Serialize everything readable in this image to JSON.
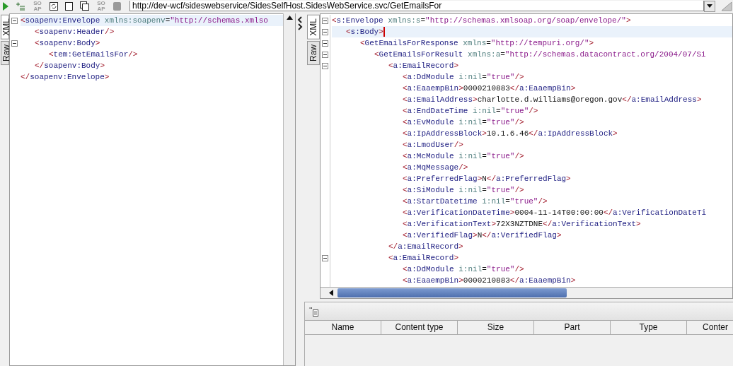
{
  "toolbar": {
    "buttons": [
      {
        "kind": "run"
      },
      {
        "kind": "add"
      },
      {
        "kind": "soap",
        "label": "SO AP"
      },
      {
        "kind": "refresh"
      },
      {
        "kind": "page"
      },
      {
        "kind": "pages"
      },
      {
        "kind": "soap",
        "label": "SO AP"
      },
      {
        "kind": "stop"
      }
    ],
    "url": "http://dev-wcf/sideswebservice/SidesSelfHost.SidesWebService.svc/GetEmailsFor"
  },
  "request": {
    "tabs": [
      {
        "label": "XML",
        "selected": true
      },
      {
        "label": "Raw",
        "selected": false
      }
    ],
    "lines": [
      {
        "expanded": true,
        "current": true,
        "tokens": [
          {
            "kind": "bracket",
            "text": "<"
          },
          {
            "kind": "tag",
            "text": "soapenv:Envelope"
          },
          {
            "kind": "attr",
            "text": " xmlns:soapenv"
          },
          {
            "kind": "equals",
            "text": "="
          },
          {
            "kind": "value",
            "text": "\"http://schemas.xmlso"
          }
        ],
        "children": [
          {
            "tokens": [
              {
                "kind": "bracket",
                "text": "<"
              },
              {
                "kind": "tag",
                "text": "soapenv:Header"
              },
              {
                "kind": "bracket",
                "text": "/>"
              }
            ]
          },
          {
            "expanded": true,
            "tokens": [
              {
                "kind": "bracket",
                "text": "<"
              },
              {
                "kind": "tag",
                "text": "soapenv:Body"
              },
              {
                "kind": "bracket",
                "text": ">"
              }
            ],
            "children": [
              {
                "tokens": [
                  {
                    "kind": "bracket",
                    "text": "<"
                  },
                  {
                    "kind": "tag",
                    "text": "tem:GetEmailsFor"
                  },
                  {
                    "kind": "bracket",
                    "text": "/>"
                  }
                ]
              }
            ]
          },
          {
            "tokens": [
              {
                "kind": "bracket",
                "text": "</"
              },
              {
                "kind": "tag",
                "text": "soapenv:Body"
              },
              {
                "kind": "bracket",
                "text": ">"
              }
            ]
          }
        ]
      },
      {
        "tokens": [
          {
            "kind": "bracket",
            "text": "</"
          },
          {
            "kind": "tag",
            "text": "soapenv:Envelope"
          },
          {
            "kind": "bracket",
            "text": ">"
          }
        ]
      }
    ]
  },
  "response": {
    "tabs": [
      {
        "label": "XML",
        "selected": true
      },
      {
        "label": "Raw",
        "selected": false
      }
    ],
    "lines": [
      {
        "expanded": true,
        "tokens": [
          {
            "kind": "bracket",
            "text": "<"
          },
          {
            "kind": "tag",
            "text": "s:Envelope"
          },
          {
            "kind": "attr",
            "text": " xmlns:s"
          },
          {
            "kind": "equals",
            "text": "="
          },
          {
            "kind": "value",
            "text": "\"http://schemas.xmlsoap.org/soap/envelope/\""
          },
          {
            "kind": "bracket",
            "text": ">"
          }
        ],
        "children": [
          {
            "expanded": true,
            "current": true,
            "tokens": [
              {
                "kind": "bracket",
                "text": "<"
              },
              {
                "kind": "tag",
                "text": "s:Body"
              },
              {
                "kind": "bracket",
                "text": ">"
              }
            ],
            "children": [
              {
                "expanded": true,
                "tokens": [
                  {
                    "kind": "bracket",
                    "text": "<"
                  },
                  {
                    "kind": "tag",
                    "text": "GetEmailsForResponse"
                  },
                  {
                    "kind": "attr",
                    "text": " xmlns"
                  },
                  {
                    "kind": "equals",
                    "text": "="
                  },
                  {
                    "kind": "value",
                    "text": "\"http://tempuri.org/\""
                  },
                  {
                    "kind": "bracket",
                    "text": ">"
                  }
                ],
                "children": [
                  {
                    "expanded": true,
                    "tokens": [
                      {
                        "kind": "bracket",
                        "text": "<"
                      },
                      {
                        "kind": "tag",
                        "text": "GetEmailsForResult"
                      },
                      {
                        "kind": "attr",
                        "text": " xmlns:a"
                      },
                      {
                        "kind": "equals",
                        "text": "="
                      },
                      {
                        "kind": "value",
                        "text": "\"http://schemas.datacontract.org/2004/07/Si"
                      }
                    ],
                    "children": [
                      {
                        "expanded": true,
                        "tokens": [
                          {
                            "kind": "bracket",
                            "text": "<"
                          },
                          {
                            "kind": "tag",
                            "text": "a:EmailRecord"
                          },
                          {
                            "kind": "bracket",
                            "text": ">"
                          }
                        ],
                        "children": [
                          {
                            "tokens": [
                              {
                                "kind": "bracket",
                                "text": "<"
                              },
                              {
                                "kind": "tag",
                                "text": "a:DdModule"
                              },
                              {
                                "kind": "attr",
                                "text": " i:nil"
                              },
                              {
                                "kind": "equals",
                                "text": "="
                              },
                              {
                                "kind": "value",
                                "text": "\"true\""
                              },
                              {
                                "kind": "bracket",
                                "text": "/>"
                              }
                            ]
                          },
                          {
                            "tokens": [
                              {
                                "kind": "bracket",
                                "text": "<"
                              },
                              {
                                "kind": "tag",
                                "text": "a:EaaempBin"
                              },
                              {
                                "kind": "bracket",
                                "text": ">"
                              },
                              {
                                "kind": "text",
                                "text": "0000210883"
                              },
                              {
                                "kind": "bracket",
                                "text": "</"
                              },
                              {
                                "kind": "tag",
                                "text": "a:EaaempBin"
                              },
                              {
                                "kind": "bracket",
                                "text": ">"
                              }
                            ]
                          },
                          {
                            "tokens": [
                              {
                                "kind": "bracket",
                                "text": "<"
                              },
                              {
                                "kind": "tag",
                                "text": "a:EmailAddress"
                              },
                              {
                                "kind": "bracket",
                                "text": ">"
                              },
                              {
                                "kind": "text",
                                "text": "charlotte.d.williams@oregon.gov"
                              },
                              {
                                "kind": "bracket",
                                "text": "</"
                              },
                              {
                                "kind": "tag",
                                "text": "a:EmailAddress"
                              },
                              {
                                "kind": "bracket",
                                "text": ">"
                              }
                            ]
                          },
                          {
                            "tokens": [
                              {
                                "kind": "bracket",
                                "text": "<"
                              },
                              {
                                "kind": "tag",
                                "text": "a:EndDateTime"
                              },
                              {
                                "kind": "attr",
                                "text": " i:nil"
                              },
                              {
                                "kind": "equals",
                                "text": "="
                              },
                              {
                                "kind": "value",
                                "text": "\"true\""
                              },
                              {
                                "kind": "bracket",
                                "text": "/>"
                              }
                            ]
                          },
                          {
                            "tokens": [
                              {
                                "kind": "bracket",
                                "text": "<"
                              },
                              {
                                "kind": "tag",
                                "text": "a:EvModule"
                              },
                              {
                                "kind": "attr",
                                "text": " i:nil"
                              },
                              {
                                "kind": "equals",
                                "text": "="
                              },
                              {
                                "kind": "value",
                                "text": "\"true\""
                              },
                              {
                                "kind": "bracket",
                                "text": "/>"
                              }
                            ]
                          },
                          {
                            "tokens": [
                              {
                                "kind": "bracket",
                                "text": "<"
                              },
                              {
                                "kind": "tag",
                                "text": "a:IpAddressBlock"
                              },
                              {
                                "kind": "bracket",
                                "text": ">"
                              },
                              {
                                "kind": "text",
                                "text": "10.1.6.46"
                              },
                              {
                                "kind": "bracket",
                                "text": "</"
                              },
                              {
                                "kind": "tag",
                                "text": "a:IpAddressBlock"
                              },
                              {
                                "kind": "bracket",
                                "text": ">"
                              }
                            ]
                          },
                          {
                            "tokens": [
                              {
                                "kind": "bracket",
                                "text": "<"
                              },
                              {
                                "kind": "tag",
                                "text": "a:LmodUser"
                              },
                              {
                                "kind": "bracket",
                                "text": "/>"
                              }
                            ]
                          },
                          {
                            "tokens": [
                              {
                                "kind": "bracket",
                                "text": "<"
                              },
                              {
                                "kind": "tag",
                                "text": "a:McModule"
                              },
                              {
                                "kind": "attr",
                                "text": " i:nil"
                              },
                              {
                                "kind": "equals",
                                "text": "="
                              },
                              {
                                "kind": "value",
                                "text": "\"true\""
                              },
                              {
                                "kind": "bracket",
                                "text": "/>"
                              }
                            ]
                          },
                          {
                            "tokens": [
                              {
                                "kind": "bracket",
                                "text": "<"
                              },
                              {
                                "kind": "tag",
                                "text": "a:MqMessage"
                              },
                              {
                                "kind": "bracket",
                                "text": "/>"
                              }
                            ]
                          },
                          {
                            "tokens": [
                              {
                                "kind": "bracket",
                                "text": "<"
                              },
                              {
                                "kind": "tag",
                                "text": "a:PreferredFlag"
                              },
                              {
                                "kind": "bracket",
                                "text": ">"
                              },
                              {
                                "kind": "text",
                                "text": "N"
                              },
                              {
                                "kind": "bracket",
                                "text": "</"
                              },
                              {
                                "kind": "tag",
                                "text": "a:PreferredFlag"
                              },
                              {
                                "kind": "bracket",
                                "text": ">"
                              }
                            ]
                          },
                          {
                            "tokens": [
                              {
                                "kind": "bracket",
                                "text": "<"
                              },
                              {
                                "kind": "tag",
                                "text": "a:SiModule"
                              },
                              {
                                "kind": "attr",
                                "text": " i:nil"
                              },
                              {
                                "kind": "equals",
                                "text": "="
                              },
                              {
                                "kind": "value",
                                "text": "\"true\""
                              },
                              {
                                "kind": "bracket",
                                "text": "/>"
                              }
                            ]
                          },
                          {
                            "tokens": [
                              {
                                "kind": "bracket",
                                "text": "<"
                              },
                              {
                                "kind": "tag",
                                "text": "a:StartDatetime"
                              },
                              {
                                "kind": "attr",
                                "text": " i:nil"
                              },
                              {
                                "kind": "equals",
                                "text": "="
                              },
                              {
                                "kind": "value",
                                "text": "\"true\""
                              },
                              {
                                "kind": "bracket",
                                "text": "/>"
                              }
                            ]
                          },
                          {
                            "tokens": [
                              {
                                "kind": "bracket",
                                "text": "<"
                              },
                              {
                                "kind": "tag",
                                "text": "a:VerificationDateTime"
                              },
                              {
                                "kind": "bracket",
                                "text": ">"
                              },
                              {
                                "kind": "text",
                                "text": "0004-11-14T00:00:00"
                              },
                              {
                                "kind": "bracket",
                                "text": "</"
                              },
                              {
                                "kind": "tag",
                                "text": "a:VerificationDateTi"
                              }
                            ]
                          },
                          {
                            "tokens": [
                              {
                                "kind": "bracket",
                                "text": "<"
                              },
                              {
                                "kind": "tag",
                                "text": "a:VerificationText"
                              },
                              {
                                "kind": "bracket",
                                "text": ">"
                              },
                              {
                                "kind": "text",
                                "text": "72X3NZTDNE"
                              },
                              {
                                "kind": "bracket",
                                "text": "</"
                              },
                              {
                                "kind": "tag",
                                "text": "a:VerificationText"
                              },
                              {
                                "kind": "bracket",
                                "text": ">"
                              }
                            ]
                          },
                          {
                            "tokens": [
                              {
                                "kind": "bracket",
                                "text": "<"
                              },
                              {
                                "kind": "tag",
                                "text": "a:VerifiedFlag"
                              },
                              {
                                "kind": "bracket",
                                "text": ">"
                              },
                              {
                                "kind": "text",
                                "text": "N"
                              },
                              {
                                "kind": "bracket",
                                "text": "</"
                              },
                              {
                                "kind": "tag",
                                "text": "a:VerifiedFlag"
                              },
                              {
                                "kind": "bracket",
                                "text": ">"
                              }
                            ]
                          }
                        ]
                      },
                      {
                        "tokens": [
                          {
                            "kind": "bracket",
                            "text": "</"
                          },
                          {
                            "kind": "tag",
                            "text": "a:EmailRecord"
                          },
                          {
                            "kind": "bracket",
                            "text": ">"
                          }
                        ]
                      },
                      {
                        "expanded": true,
                        "tokens": [
                          {
                            "kind": "bracket",
                            "text": "<"
                          },
                          {
                            "kind": "tag",
                            "text": "a:EmailRecord"
                          },
                          {
                            "kind": "bracket",
                            "text": ">"
                          }
                        ],
                        "children": [
                          {
                            "tokens": [
                              {
                                "kind": "bracket",
                                "text": "<"
                              },
                              {
                                "kind": "tag",
                                "text": "a:DdModule"
                              },
                              {
                                "kind": "attr",
                                "text": " i:nil"
                              },
                              {
                                "kind": "equals",
                                "text": "="
                              },
                              {
                                "kind": "value",
                                "text": "\"true\""
                              },
                              {
                                "kind": "bracket",
                                "text": "/>"
                              }
                            ]
                          },
                          {
                            "tokens": [
                              {
                                "kind": "bracket",
                                "text": "<"
                              },
                              {
                                "kind": "tag",
                                "text": "a:EaaempBin"
                              },
                              {
                                "kind": "bracket",
                                "text": ">"
                              },
                              {
                                "kind": "text",
                                "text": "0000210883"
                              },
                              {
                                "kind": "bracket",
                                "text": "</"
                              },
                              {
                                "kind": "tag",
                                "text": "a:EaaempBin"
                              },
                              {
                                "kind": "bracket",
                                "text": ">"
                              }
                            ]
                          }
                        ]
                      }
                    ]
                  }
                ]
              }
            ]
          }
        ]
      }
    ]
  },
  "attachments": {
    "columns": [
      "Name",
      "Content type",
      "Size",
      "Part",
      "Type",
      "Conter"
    ]
  }
}
